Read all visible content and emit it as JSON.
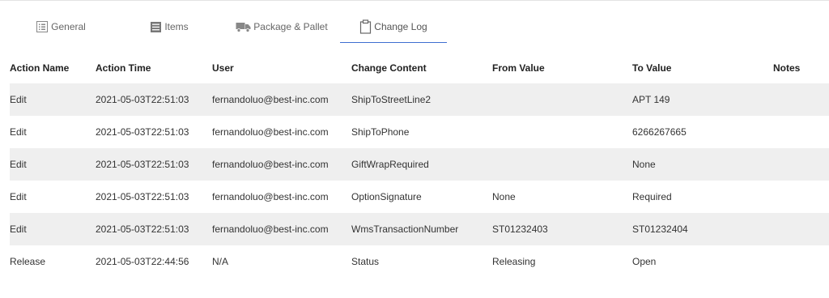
{
  "tabs": [
    {
      "label": "General",
      "icon": "list-box-icon",
      "active": false
    },
    {
      "label": "Items",
      "icon": "list-icon",
      "active": false
    },
    {
      "label": "Package & Pallet",
      "icon": "truck-icon",
      "active": false
    },
    {
      "label": "Change Log",
      "icon": "clipboard-icon",
      "active": true
    }
  ],
  "table": {
    "headers": [
      "Action Name",
      "Action Time",
      "User",
      "Change Content",
      "From Value",
      "To Value",
      "Notes"
    ],
    "rows": [
      [
        "Edit",
        "2021-05-03T22:51:03",
        "fernandoluo@best-inc.com",
        "ShipToStreetLine2",
        "",
        "APT 149",
        ""
      ],
      [
        "Edit",
        "2021-05-03T22:51:03",
        "fernandoluo@best-inc.com",
        "ShipToPhone",
        "",
        "6266267665",
        ""
      ],
      [
        "Edit",
        "2021-05-03T22:51:03",
        "fernandoluo@best-inc.com",
        "GiftWrapRequired",
        "",
        "None",
        ""
      ],
      [
        "Edit",
        "2021-05-03T22:51:03",
        "fernandoluo@best-inc.com",
        "OptionSignature",
        "None",
        "Required",
        ""
      ],
      [
        "Edit",
        "2021-05-03T22:51:03",
        "fernandoluo@best-inc.com",
        "WmsTransactionNumber",
        "ST01232403",
        "ST01232404",
        ""
      ],
      [
        "Release",
        "2021-05-03T22:44:56",
        "N/A",
        "Status",
        "Releasing",
        "Open",
        ""
      ]
    ]
  },
  "colors": {
    "accent": "#3f6fd1",
    "stripe": "#efefef",
    "icon": "#888888"
  }
}
